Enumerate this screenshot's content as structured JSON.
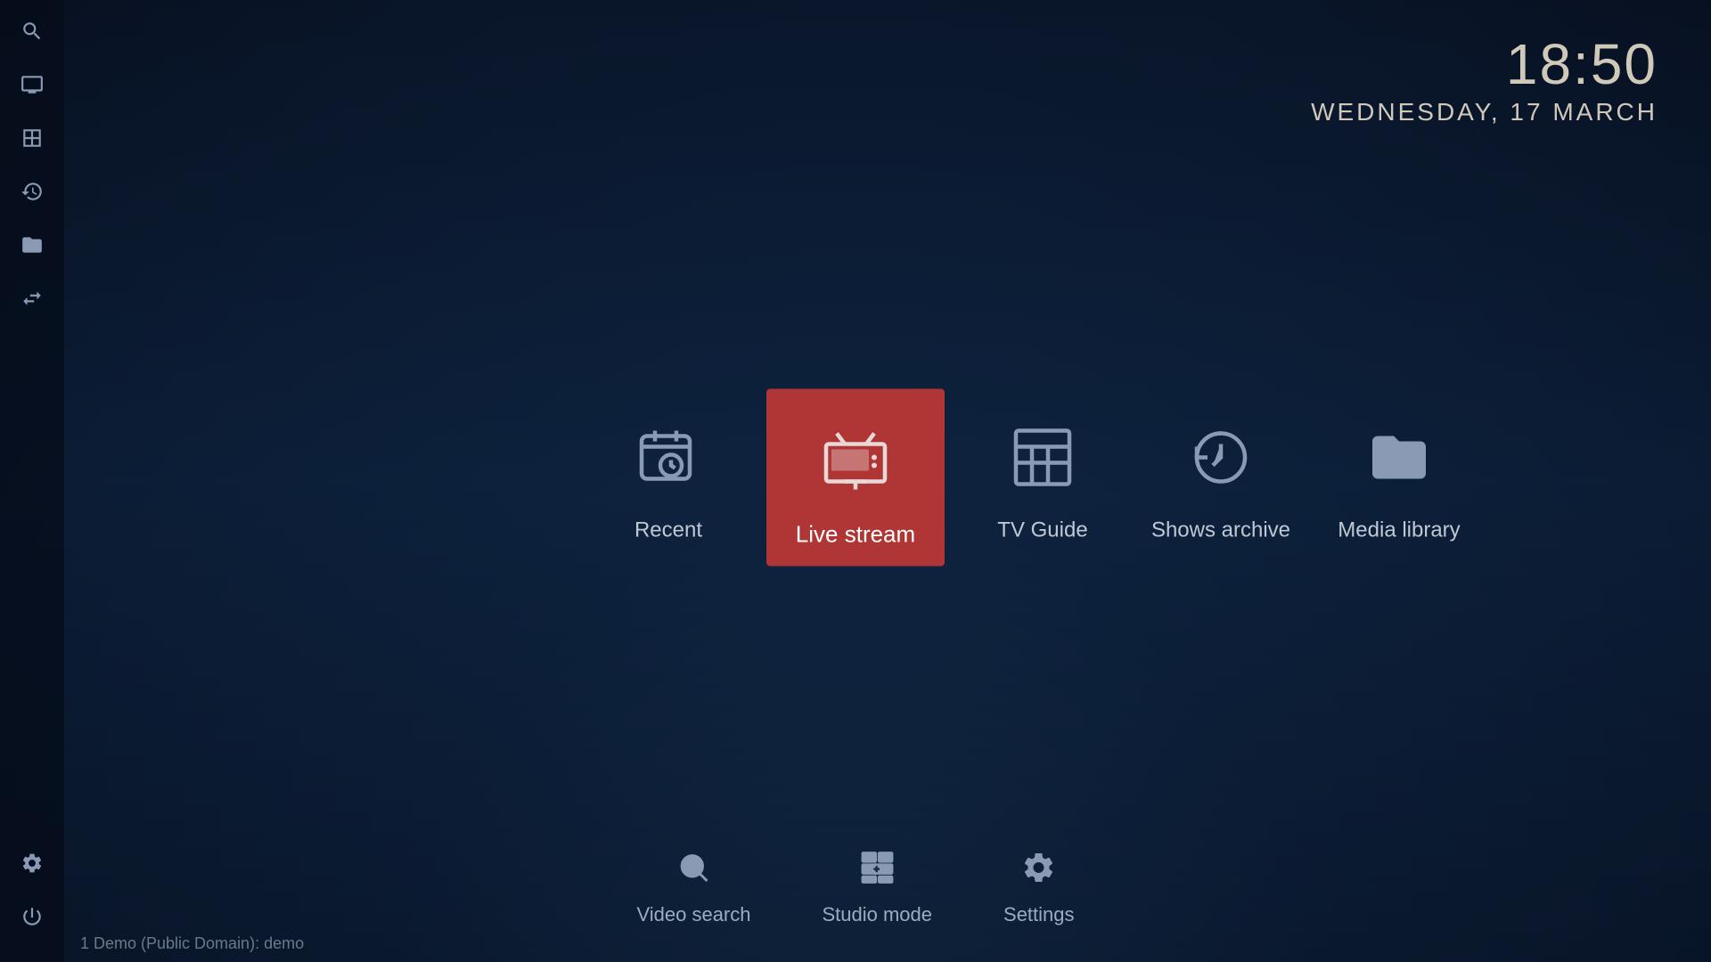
{
  "clock": {
    "time": "18:50",
    "date": "Wednesday, 17 March"
  },
  "sidebar": {
    "items": [
      {
        "name": "search",
        "label": "Search"
      },
      {
        "name": "live-tv",
        "label": "Live TV"
      },
      {
        "name": "tv-guide",
        "label": "TV Guide"
      },
      {
        "name": "history",
        "label": "History"
      },
      {
        "name": "media-library",
        "label": "Media Library"
      },
      {
        "name": "switch",
        "label": "Switch"
      },
      {
        "name": "settings",
        "label": "Settings"
      },
      {
        "name": "power",
        "label": "Power"
      }
    ]
  },
  "main_items": [
    {
      "id": "recent",
      "label": "Recent",
      "active": false
    },
    {
      "id": "live-stream",
      "label": "Live stream",
      "active": true
    },
    {
      "id": "tv-guide",
      "label": "TV Guide",
      "active": false
    },
    {
      "id": "shows-archive",
      "label": "Shows archive",
      "active": false
    },
    {
      "id": "media-library",
      "label": "Media library",
      "active": false
    }
  ],
  "bottom_items": [
    {
      "id": "video-search",
      "label": "Video search"
    },
    {
      "id": "studio-mode",
      "label": "Studio mode"
    },
    {
      "id": "settings",
      "label": "Settings"
    }
  ],
  "status": {
    "text": "1 Demo (Public Domain): demo"
  },
  "colors": {
    "active_bg": "#b03535",
    "sidebar_bg": "rgba(5,12,25,0.75)",
    "icon_color": "#8a9ab5",
    "text_color": "#c0c8d4",
    "clock_color": "#d0c8b8"
  }
}
